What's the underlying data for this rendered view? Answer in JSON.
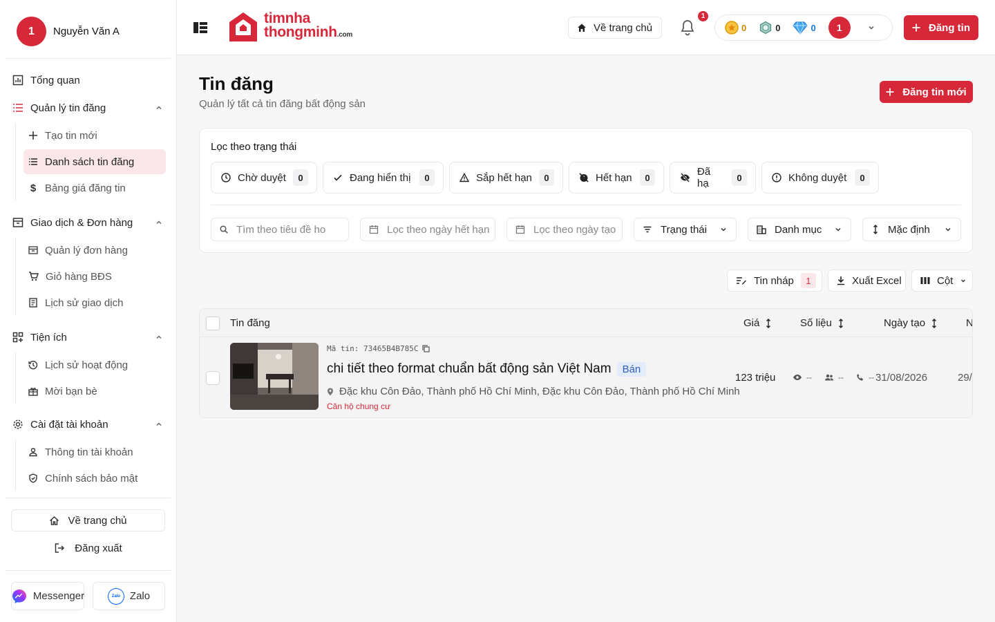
{
  "sidebar": {
    "user": {
      "initial": "1",
      "name": "Nguyễn Văn A"
    },
    "nav": {
      "overview": "Tổng quan",
      "listings": {
        "label": "Quản lý tin đăng",
        "items": [
          "Tạo tin mới",
          "Danh sách tin đăng",
          "Bảng giá đăng tin"
        ]
      },
      "transactions": {
        "label": "Giao dịch & Đơn hàng",
        "items": [
          "Quản lý đơn hàng",
          "Giỏ hàng BĐS",
          "Lịch sử giao dịch"
        ]
      },
      "utilities": {
        "label": "Tiện ích",
        "items": [
          "Lịch sử hoạt động",
          "Mời bạn bè"
        ]
      },
      "settings": {
        "label": "Cài đặt tài khoản",
        "items": [
          "Thông tin tài khoản",
          "Chính sách bảo mật"
        ]
      }
    },
    "home_label": "Về trang chủ",
    "logout_label": "Đăng xuất",
    "messenger_label": "Messenger",
    "zalo_label": "Zalo",
    "zalo_icon_text": "Zalo"
  },
  "header": {
    "logo_line1": "timnha",
    "logo_line2": "thongminh",
    "logo_suffix": ".com",
    "home_label": "Về trang chủ",
    "notification_count": "1",
    "wallet": {
      "gold": "0",
      "silver": "0",
      "diamond": "0",
      "avatar_initial": "1"
    },
    "post_label": "Đăng tin"
  },
  "page": {
    "title": "Tin đăng",
    "subtitle": "Quản lý tất cả tin đăng bất động sản",
    "new_post_label": "Đăng tin mới"
  },
  "filters": {
    "label": "Lọc theo trạng thái",
    "statuses": [
      {
        "label": "Chờ duyệt",
        "count": "0"
      },
      {
        "label": "Đang hiển thị",
        "count": "0"
      },
      {
        "label": "Sắp hết hạn",
        "count": "0"
      },
      {
        "label": "Hết hạn",
        "count": "0"
      },
      {
        "label": "Đã hạ",
        "count": "0"
      },
      {
        "label": "Không duyệt",
        "count": "0"
      }
    ],
    "search_placeholder": "Tìm theo tiêu đề hoặc mã tin",
    "expiry_placeholder": "Lọc theo ngày hết hạn",
    "created_placeholder": "Lọc theo ngày tạo",
    "status_select": "Trạng thái",
    "category_select": "Danh mục",
    "sort_select": "Mặc định"
  },
  "toolbar": {
    "drafts_label": "Tin nháp",
    "drafts_count": "1",
    "export_label": "Xuất Excel",
    "columns_label": "Cột"
  },
  "table": {
    "columns": [
      "Tin đăng",
      "Giá",
      "Số liệu",
      "Ngày tạo",
      "N"
    ],
    "rows": [
      {
        "code": "Mã tin: 73465B4B785C",
        "title": "chi tiết theo format chuẩn bất động sản Việt Nam",
        "badge": "Bán",
        "address": "Đặc khu Côn Đảo, Thành phố Hồ Chí Minh, Đặc khu Côn Đảo, Thành phố Hồ Chí Minh",
        "category": "Căn hộ chung cư",
        "price": "123 triệu",
        "views": "--",
        "contacts": "--",
        "calls": "--",
        "created": "31/08/2026",
        "next_col": "29/"
      }
    ]
  },
  "colors": {
    "brand": "#d62839",
    "active_bg": "#fbe7ea",
    "badge_blue": "#2f5fb3"
  },
  "icons": [
    "menu-toggle-icon",
    "home-icon",
    "bell-icon",
    "gold-coin-icon",
    "silver-coin-icon",
    "diamond-icon",
    "plus-icon",
    "clock-icon",
    "check-icon",
    "warning-icon",
    "expired-icon",
    "hidden-icon",
    "info-icon",
    "search-icon",
    "calendar-icon",
    "filter-icon",
    "building-icon",
    "sort-icon",
    "chevron-down-icon",
    "draft-icon",
    "download-icon",
    "columns-icon",
    "eye-icon",
    "users-icon",
    "phone-icon",
    "pin-icon",
    "copy-icon"
  ]
}
